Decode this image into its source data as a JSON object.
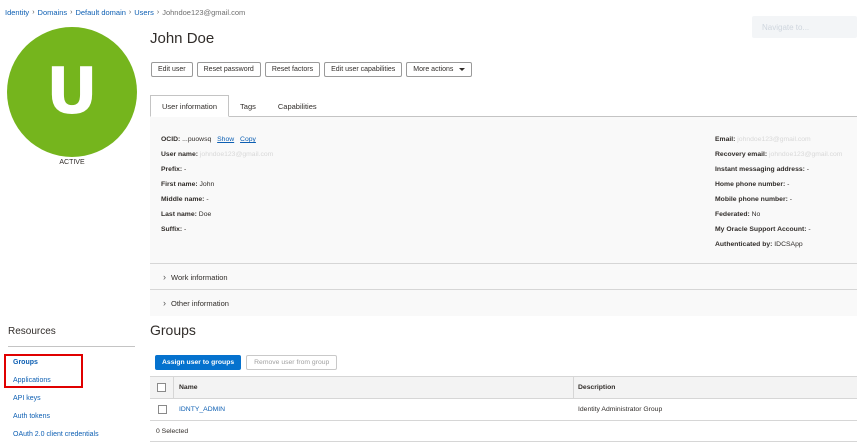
{
  "breadcrumb": {
    "items": [
      "Identity",
      "Domains",
      "Default domain",
      "Users"
    ],
    "current": "Johndoe123@gmail.com",
    "separator": "›"
  },
  "search": {
    "placeholder": "Navigate to..."
  },
  "user": {
    "avatar_letter": "U",
    "avatar_color": "#75b51d",
    "status": "ACTIVE",
    "display_name": "John Doe"
  },
  "actions": {
    "edit_user": "Edit user",
    "reset_password": "Reset password",
    "reset_factors": "Reset factors",
    "edit_capabilities": "Edit user capabilities",
    "more_actions": "More actions"
  },
  "tabs": [
    "User information",
    "Tags",
    "Capabilities"
  ],
  "user_info": {
    "left": {
      "ocid_label": "OCID:",
      "ocid_value": "...puowsq",
      "show": "Show",
      "copy": "Copy",
      "username_label": "User name:",
      "username_value": "johndoe123@gmail.com",
      "prefix_label": "Prefix:",
      "prefix_value": "-",
      "first_label": "First name:",
      "first_value": "John",
      "middle_label": "Middle name:",
      "middle_value": "-",
      "last_label": "Last name:",
      "last_value": "Doe",
      "suffix_label": "Suffix:",
      "suffix_value": "-"
    },
    "right": {
      "email_label": "Email:",
      "email_value": "johndoe123@gmail.com",
      "recovery_label": "Recovery email:",
      "recovery_value": "johndoe123@gmail.com",
      "im_label": "Instant messaging address:",
      "im_value": "-",
      "home_label": "Home phone number:",
      "home_value": "-",
      "mobile_label": "Mobile phone number:",
      "mobile_value": "-",
      "federated_label": "Federated:",
      "federated_value": "No",
      "support_label": "My Oracle Support Account:",
      "support_value": "-",
      "auth_label": "Authenticated by:",
      "auth_value": "IDCSApp"
    },
    "sections": [
      "Work information",
      "Other information"
    ]
  },
  "groups": {
    "title": "Groups",
    "assign_button": "Assign user to groups",
    "remove_button": "Remove user from group",
    "columns": {
      "name": "Name",
      "description": "Description"
    },
    "rows": [
      {
        "name": "IDNTY_ADMIN",
        "description": "Identity Administrator Group"
      }
    ],
    "selected_text": "0 Selected"
  },
  "resources": {
    "title": "Resources",
    "items": [
      "Groups",
      "Applications",
      "API keys",
      "Auth tokens",
      "OAuth 2.0 client credentials"
    ]
  }
}
